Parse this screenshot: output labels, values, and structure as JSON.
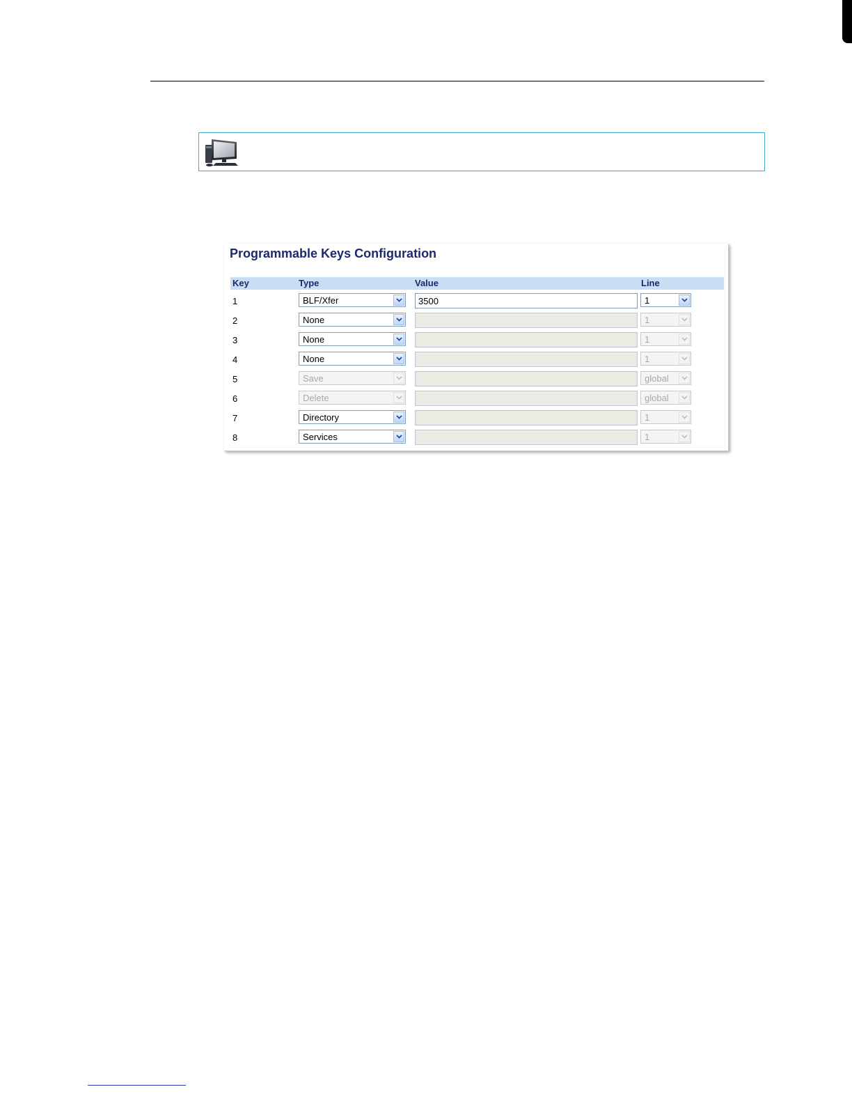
{
  "panel": {
    "title": "Programmable Keys Configuration",
    "columns": [
      "Key",
      "Type",
      "Value",
      "Line"
    ],
    "rows": [
      {
        "key": "1",
        "type": "BLF/Xfer",
        "value": "3500",
        "line": "1",
        "type_enabled": true,
        "value_enabled": true,
        "line_enabled": true
      },
      {
        "key": "2",
        "type": "None",
        "value": "",
        "line": "1",
        "type_enabled": true,
        "value_enabled": false,
        "line_enabled": false
      },
      {
        "key": "3",
        "type": "None",
        "value": "",
        "line": "1",
        "type_enabled": true,
        "value_enabled": false,
        "line_enabled": false
      },
      {
        "key": "4",
        "type": "None",
        "value": "",
        "line": "1",
        "type_enabled": true,
        "value_enabled": false,
        "line_enabled": false
      },
      {
        "key": "5",
        "type": "Save",
        "value": "",
        "line": "global",
        "type_enabled": false,
        "value_enabled": false,
        "line_enabled": false
      },
      {
        "key": "6",
        "type": "Delete",
        "value": "",
        "line": "global",
        "type_enabled": false,
        "value_enabled": false,
        "line_enabled": false
      },
      {
        "key": "7",
        "type": "Directory",
        "value": "",
        "line": "1",
        "type_enabled": true,
        "value_enabled": false,
        "line_enabled": false
      },
      {
        "key": "8",
        "type": "Services",
        "value": "",
        "line": "1",
        "type_enabled": true,
        "value_enabled": false,
        "line_enabled": false
      }
    ]
  },
  "icons": {
    "note": "computer-monitor-icon",
    "dropdown": "chevron-down-icon"
  },
  "colors": {
    "title": "#1a2a6c",
    "header_bg": "#c9ddf3",
    "note_border": "#3fa9c9"
  }
}
